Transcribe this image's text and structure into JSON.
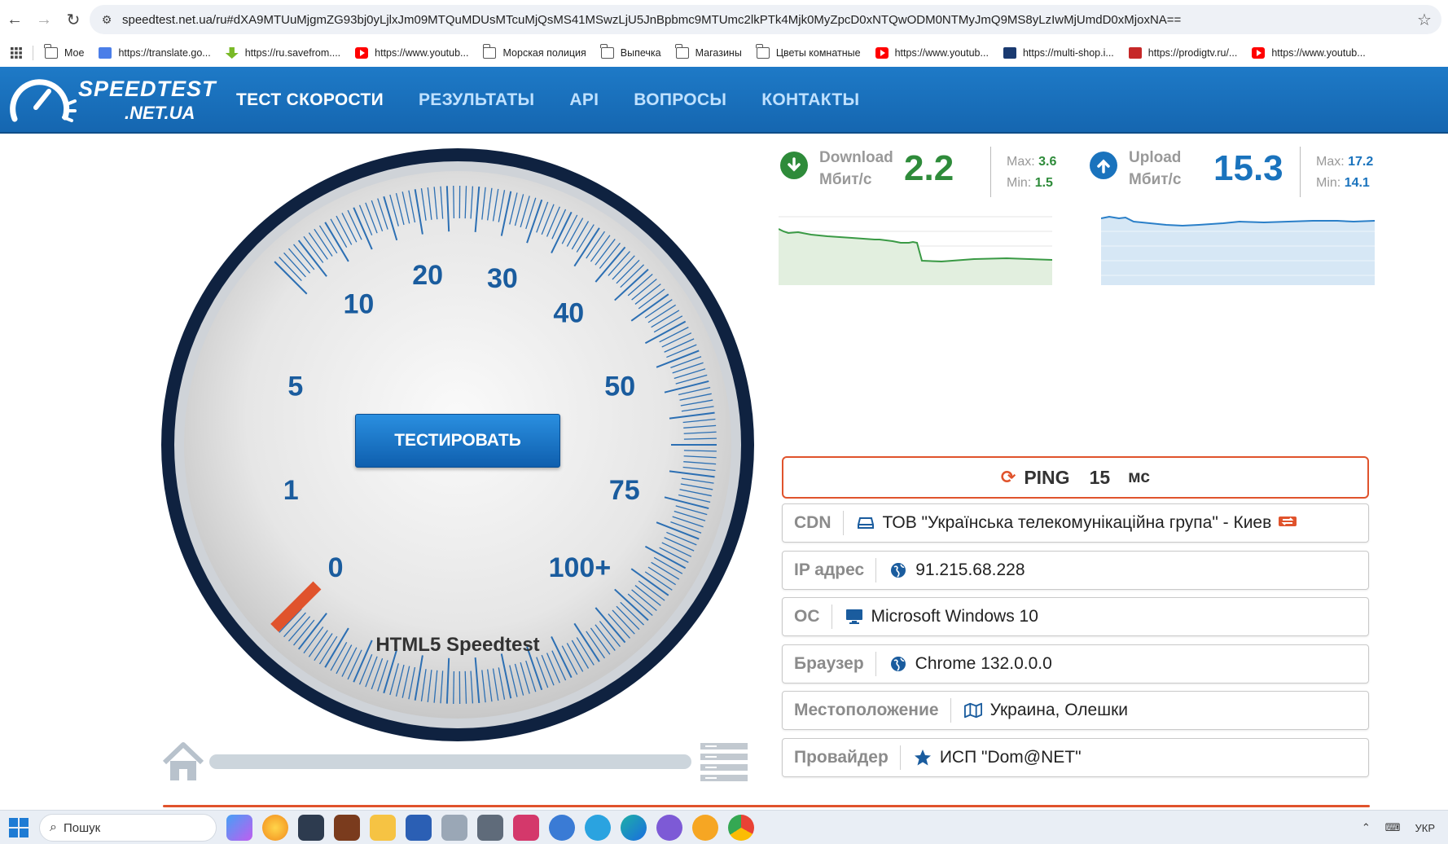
{
  "browser": {
    "url": "speedtest.net.ua/ru#dXA9MTUuMjgmZG93bj0yLjlxJm09MTQuMDUsMTcuMjQsMS41MSwzLjU5JnBpbmc9MTUmc2lkPTk4Mjk0MyZpcD0xNTQwODM0NTMyJmQ9MS8yLzIwMjUmdD0xMjoxNA==",
    "bookmarks": [
      {
        "label": "Мое",
        "icon": "folder-icon"
      },
      {
        "label": "https://translate.go...",
        "icon": "translate-icon"
      },
      {
        "label": "https://ru.savefrom....",
        "icon": "savefrom-icon"
      },
      {
        "label": "https://www.youtub...",
        "icon": "youtube-icon"
      },
      {
        "label": "Морская полиция",
        "icon": "folder-icon"
      },
      {
        "label": "Выпечка",
        "icon": "folder-icon"
      },
      {
        "label": "Магазины",
        "icon": "folder-icon"
      },
      {
        "label": "Цветы комнатные",
        "icon": "folder-icon"
      },
      {
        "label": "https://www.youtub...",
        "icon": "youtube-icon"
      },
      {
        "label": "https://multi-shop.i...",
        "icon": "multishop-icon"
      },
      {
        "label": "https://prodigtv.ru/...",
        "icon": "gmail-icon"
      },
      {
        "label": "https://www.youtub...",
        "icon": "youtube-icon"
      }
    ]
  },
  "site": {
    "logo_line1": "SPEEDTEST",
    "logo_line2": ".NET.UA",
    "menu": [
      {
        "label": "ТЕСТ СКОРОСТИ",
        "active": true
      },
      {
        "label": "РЕЗУЛЬТАТЫ",
        "active": false
      },
      {
        "label": "API",
        "active": false
      },
      {
        "label": "ВОПРОСЫ",
        "active": false
      },
      {
        "label": "КОНТАКТЫ",
        "active": false
      }
    ],
    "accent_color": "#1a73bd"
  },
  "gauge": {
    "tick_labels": [
      "0",
      "1",
      "5",
      "10",
      "20",
      "30",
      "40",
      "50",
      "75",
      "100+"
    ],
    "needle_value": "0",
    "button_label": "ТЕСТИРОВАТЬ",
    "caption": "HTML5 Speedtest",
    "needle_color": "#e0532c",
    "label_color": "#1a5c9e",
    "progress_fraction": 0
  },
  "download": {
    "label_line1": "Download",
    "label_line2": "Мбит/с",
    "value": "2.2",
    "max_label": "Max:",
    "max_value": "3.6",
    "min_label": "Min:",
    "min_value": "1.5",
    "color": "#2e8b3a",
    "icon": "arrow-down-icon"
  },
  "upload": {
    "label_line1": "Upload",
    "label_line2": "Мбит/с",
    "value": "15.3",
    "max_label": "Max:",
    "max_value": "17.2",
    "min_label": "Min:",
    "min_value": "14.1",
    "color": "#1a73bd",
    "icon": "arrow-up-icon"
  },
  "ping": {
    "label": "PING",
    "value": "15",
    "unit": "мс"
  },
  "info": [
    {
      "label": "CDN",
      "value": "ТОВ \"Українська телекомунікаційна група\" - Киев",
      "icon": "server-icon"
    },
    {
      "label": "IP адрес",
      "value": "91.215.68.228",
      "icon": "globe-icon"
    },
    {
      "label": "ОС",
      "value": "Microsoft Windows 10",
      "icon": "monitor-icon"
    },
    {
      "label": "Браузер",
      "value": "Chrome 132.0.0.0",
      "icon": "globe-icon"
    },
    {
      "label": "Местоположение",
      "value": "Украина, Олешки",
      "icon": "map-icon"
    },
    {
      "label": "Провайдер",
      "value": "ИСП \"Dom@NET\"",
      "icon": "star-icon"
    }
  ],
  "taskbar": {
    "search_placeholder": "Пошук",
    "language": "УКР"
  }
}
